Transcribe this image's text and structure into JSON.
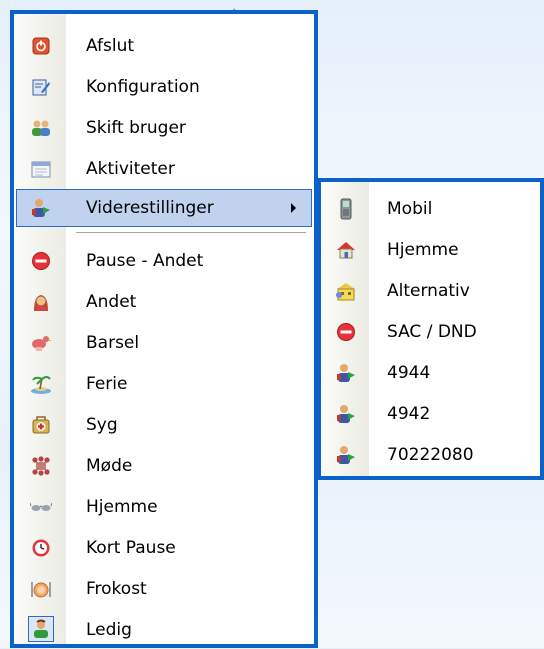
{
  "main_menu": {
    "items": [
      {
        "label": "Afslut",
        "icon": "shutdown-icon"
      },
      {
        "label": "Konfiguration",
        "icon": "configuration-icon"
      },
      {
        "label": "Skift bruger",
        "icon": "switch-user-icon"
      },
      {
        "label": "Aktiviteter",
        "icon": "activities-icon"
      },
      {
        "label": "Viderestillinger",
        "icon": "forwarding-user-icon",
        "selected": true,
        "has_submenu": true
      },
      {
        "label": "Pause - Andet",
        "icon": "no-entry-icon"
      },
      {
        "label": "Andet",
        "icon": "person-icon"
      },
      {
        "label": "Barsel",
        "icon": "stork-icon"
      },
      {
        "label": "Ferie",
        "icon": "palm-island-icon"
      },
      {
        "label": "Syg",
        "icon": "first-aid-kit-icon"
      },
      {
        "label": "Møde",
        "icon": "meeting-icon"
      },
      {
        "label": "Hjemme",
        "icon": "glasses-icon"
      },
      {
        "label": "Kort Pause",
        "icon": "clock-icon"
      },
      {
        "label": "Frokost",
        "icon": "lunch-icon"
      },
      {
        "label": "Ledig",
        "icon": "available-user-icon",
        "checked": true
      }
    ]
  },
  "sub_menu": {
    "items": [
      {
        "label": "Mobil",
        "icon": "mobile-phone-icon"
      },
      {
        "label": "Hjemme",
        "icon": "home-icon"
      },
      {
        "label": "Alternativ",
        "icon": "alternative-building-icon"
      },
      {
        "label": "SAC / DND",
        "icon": "no-entry-icon"
      },
      {
        "label": "4944",
        "icon": "forwarding-user-icon"
      },
      {
        "label": "4942",
        "icon": "forwarding-user-icon"
      },
      {
        "label": "70222080",
        "icon": "forwarding-user-icon"
      }
    ]
  },
  "colors": {
    "menu_border": "#0b63c9",
    "selection": "#c1d2ee",
    "selection_border": "#316ac5"
  }
}
